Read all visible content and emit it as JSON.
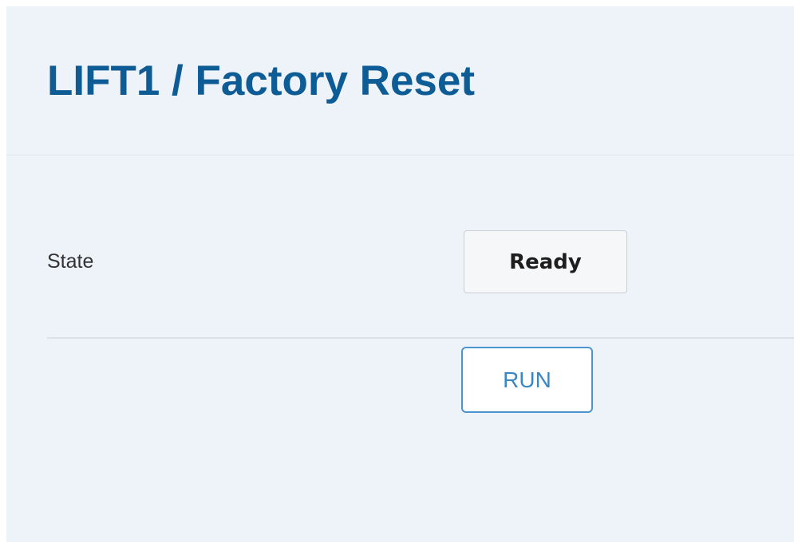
{
  "header": {
    "title": "LIFT1 / Factory Reset"
  },
  "status": {
    "label": "State",
    "value": "Ready"
  },
  "actions": {
    "run_label": "RUN"
  },
  "colors": {
    "title": "#0d5c96",
    "background": "#eef2f9",
    "run_border": "#4a95cf",
    "run_text": "#3a87c4"
  }
}
